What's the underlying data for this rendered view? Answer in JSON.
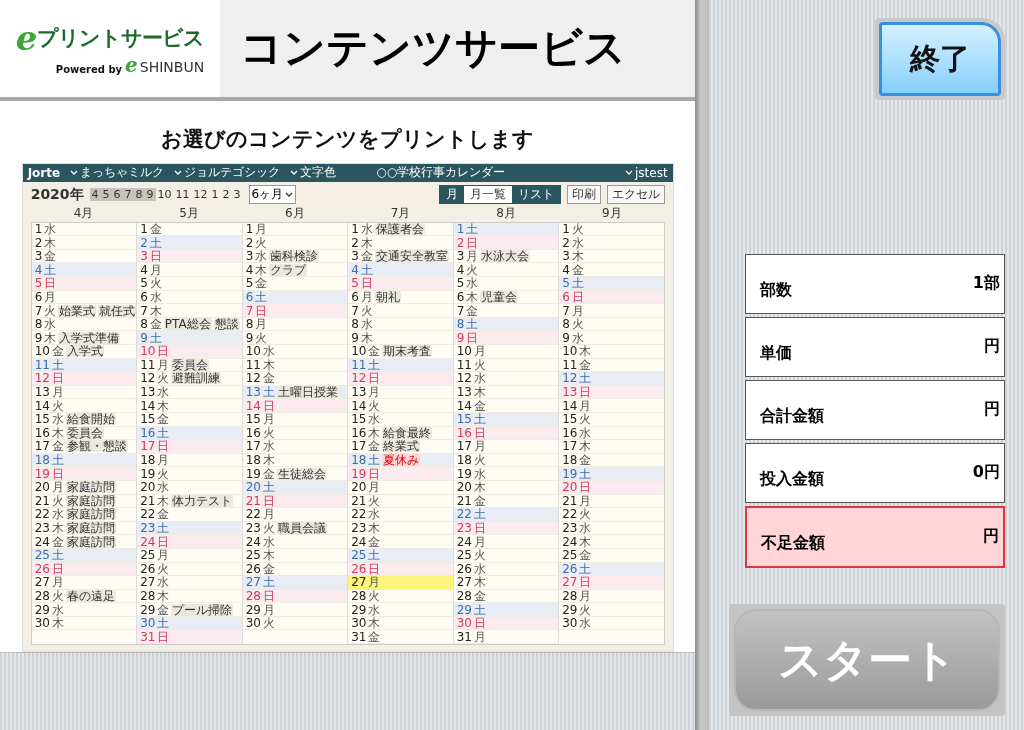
{
  "header": {
    "logo": {
      "mark": "e",
      "name": "プリントサービス",
      "powered_by": "Powered by",
      "partner_mark": "e",
      "partner_name": "SHINBUN"
    },
    "title": "コンテンツサービス"
  },
  "message": "お選びのコンテンツをプリントします",
  "calendar": {
    "app_name": "Jorte",
    "menus": [
      "まっちゃミルク",
      "ジョルテゴシック",
      "文字色"
    ],
    "calendar_name": "○○学校行事カレンダー",
    "user": "jstest",
    "year": "2020年",
    "month_chips": [
      {
        "label": "4",
        "selected": true
      },
      {
        "label": "5",
        "selected": true
      },
      {
        "label": "6",
        "selected": true
      },
      {
        "label": "7",
        "selected": true
      },
      {
        "label": "8",
        "selected": true
      },
      {
        "label": "9",
        "selected": true
      },
      {
        "label": "10",
        "selected": false
      },
      {
        "label": "11",
        "selected": false
      },
      {
        "label": "12",
        "selected": false
      },
      {
        "label": "1",
        "selected": false
      },
      {
        "label": "2",
        "selected": false
      },
      {
        "label": "3",
        "selected": false
      }
    ],
    "range": "6ヶ月",
    "views": [
      {
        "label": "月",
        "selected": true
      },
      {
        "label": "月一覧",
        "selected": false
      },
      {
        "label": "リスト",
        "selected": true
      }
    ],
    "actions": [
      "印刷",
      "エクセル"
    ],
    "months": [
      {
        "title": "4月",
        "days": [
          {
            "d": "1",
            "w": "水",
            "kind": "wd"
          },
          {
            "d": "2",
            "w": "木",
            "kind": "wd"
          },
          {
            "d": "3",
            "w": "金",
            "kind": "wd"
          },
          {
            "d": "4",
            "w": "土",
            "kind": "sat"
          },
          {
            "d": "5",
            "w": "日",
            "kind": "sun"
          },
          {
            "d": "6",
            "w": "月",
            "kind": "wd"
          },
          {
            "d": "7",
            "w": "火",
            "kind": "wd",
            "events": [
              {
                "text": "始業式",
                "kind": "tag"
              },
              {
                "text": "就任式",
                "kind": "tag"
              }
            ]
          },
          {
            "d": "8",
            "w": "水",
            "kind": "wd"
          },
          {
            "d": "9",
            "w": "木",
            "kind": "wd",
            "events": [
              {
                "text": "入学式準備",
                "kind": "tag"
              }
            ]
          },
          {
            "d": "10",
            "w": "金",
            "kind": "wd",
            "events": [
              {
                "text": "入学式",
                "kind": "tag"
              }
            ]
          },
          {
            "d": "11",
            "w": "土",
            "kind": "sat"
          },
          {
            "d": "12",
            "w": "日",
            "kind": "sun"
          },
          {
            "d": "13",
            "w": "月",
            "kind": "wd"
          },
          {
            "d": "14",
            "w": "火",
            "kind": "wd"
          },
          {
            "d": "15",
            "w": "水",
            "kind": "wd",
            "events": [
              {
                "text": "給食開始",
                "kind": "tag"
              }
            ]
          },
          {
            "d": "16",
            "w": "木",
            "kind": "wd",
            "events": [
              {
                "text": "委員会",
                "kind": "tag"
              }
            ]
          },
          {
            "d": "17",
            "w": "金",
            "kind": "wd",
            "events": [
              {
                "text": "参観・懇談",
                "kind": "tag"
              }
            ]
          },
          {
            "d": "18",
            "w": "土",
            "kind": "sat"
          },
          {
            "d": "19",
            "w": "日",
            "kind": "sun"
          },
          {
            "d": "20",
            "w": "月",
            "kind": "wd",
            "events": [
              {
                "text": "家庭訪問",
                "kind": "tag"
              }
            ]
          },
          {
            "d": "21",
            "w": "火",
            "kind": "wd",
            "events": [
              {
                "text": "家庭訪問",
                "kind": "tag"
              }
            ]
          },
          {
            "d": "22",
            "w": "水",
            "kind": "wd",
            "events": [
              {
                "text": "家庭訪問",
                "kind": "tag"
              }
            ]
          },
          {
            "d": "23",
            "w": "木",
            "kind": "wd",
            "events": [
              {
                "text": "家庭訪問",
                "kind": "tag"
              }
            ]
          },
          {
            "d": "24",
            "w": "金",
            "kind": "wd",
            "events": [
              {
                "text": "家庭訪問",
                "kind": "tag"
              }
            ]
          },
          {
            "d": "25",
            "w": "土",
            "kind": "sat"
          },
          {
            "d": "26",
            "w": "日",
            "kind": "sun"
          },
          {
            "d": "27",
            "w": "月",
            "kind": "wd"
          },
          {
            "d": "28",
            "w": "火",
            "kind": "wd",
            "events": [
              {
                "text": "春の遠足",
                "kind": "tag"
              }
            ]
          },
          {
            "d": "29",
            "w": "水",
            "kind": "wd"
          },
          {
            "d": "30",
            "w": "木",
            "kind": "wd"
          }
        ]
      },
      {
        "title": "5月",
        "days": [
          {
            "d": "1",
            "w": "金",
            "kind": "wd"
          },
          {
            "d": "2",
            "w": "土",
            "kind": "sat"
          },
          {
            "d": "3",
            "w": "日",
            "kind": "sun"
          },
          {
            "d": "4",
            "w": "月",
            "kind": "wd"
          },
          {
            "d": "5",
            "w": "火",
            "kind": "wd"
          },
          {
            "d": "6",
            "w": "水",
            "kind": "wd"
          },
          {
            "d": "7",
            "w": "木",
            "kind": "wd"
          },
          {
            "d": "8",
            "w": "金",
            "kind": "wd",
            "events": [
              {
                "text": "PTA総会",
                "kind": "tag"
              },
              {
                "text": "懇談",
                "kind": "tag"
              }
            ]
          },
          {
            "d": "9",
            "w": "土",
            "kind": "sat"
          },
          {
            "d": "10",
            "w": "日",
            "kind": "sun"
          },
          {
            "d": "11",
            "w": "月",
            "kind": "wd",
            "events": [
              {
                "text": "委員会",
                "kind": "tag"
              }
            ]
          },
          {
            "d": "12",
            "w": "火",
            "kind": "wd",
            "events": [
              {
                "text": "避難訓練",
                "kind": "tag"
              }
            ]
          },
          {
            "d": "13",
            "w": "水",
            "kind": "wd"
          },
          {
            "d": "14",
            "w": "木",
            "kind": "wd"
          },
          {
            "d": "15",
            "w": "金",
            "kind": "wd"
          },
          {
            "d": "16",
            "w": "土",
            "kind": "sat"
          },
          {
            "d": "17",
            "w": "日",
            "kind": "sun"
          },
          {
            "d": "18",
            "w": "月",
            "kind": "wd"
          },
          {
            "d": "19",
            "w": "火",
            "kind": "wd"
          },
          {
            "d": "20",
            "w": "水",
            "kind": "wd"
          },
          {
            "d": "21",
            "w": "木",
            "kind": "wd",
            "events": [
              {
                "text": "体力テスト",
                "kind": "tag"
              }
            ]
          },
          {
            "d": "22",
            "w": "金",
            "kind": "wd"
          },
          {
            "d": "23",
            "w": "土",
            "kind": "sat"
          },
          {
            "d": "24",
            "w": "日",
            "kind": "sun"
          },
          {
            "d": "25",
            "w": "月",
            "kind": "wd"
          },
          {
            "d": "26",
            "w": "火",
            "kind": "wd"
          },
          {
            "d": "27",
            "w": "水",
            "kind": "wd"
          },
          {
            "d": "28",
            "w": "木",
            "kind": "wd"
          },
          {
            "d": "29",
            "w": "金",
            "kind": "wd",
            "events": [
              {
                "text": "プール掃除",
                "kind": "tag"
              }
            ]
          },
          {
            "d": "30",
            "w": "土",
            "kind": "sat"
          },
          {
            "d": "31",
            "w": "日",
            "kind": "sun"
          }
        ]
      },
      {
        "title": "6月",
        "days": [
          {
            "d": "1",
            "w": "月",
            "kind": "wd"
          },
          {
            "d": "2",
            "w": "火",
            "kind": "wd"
          },
          {
            "d": "3",
            "w": "水",
            "kind": "wd",
            "events": [
              {
                "text": "歯科検診",
                "kind": "tag"
              }
            ]
          },
          {
            "d": "4",
            "w": "木",
            "kind": "wd",
            "events": [
              {
                "text": "クラブ",
                "kind": "tag"
              }
            ]
          },
          {
            "d": "5",
            "w": "金",
            "kind": "wd"
          },
          {
            "d": "6",
            "w": "土",
            "kind": "sat"
          },
          {
            "d": "7",
            "w": "日",
            "kind": "sun"
          },
          {
            "d": "8",
            "w": "月",
            "kind": "wd"
          },
          {
            "d": "9",
            "w": "火",
            "kind": "wd"
          },
          {
            "d": "10",
            "w": "水",
            "kind": "wd"
          },
          {
            "d": "11",
            "w": "木",
            "kind": "wd"
          },
          {
            "d": "12",
            "w": "金",
            "kind": "wd"
          },
          {
            "d": "13",
            "w": "土",
            "kind": "sat",
            "events": [
              {
                "text": "土曜日授業",
                "kind": "tag"
              }
            ]
          },
          {
            "d": "14",
            "w": "日",
            "kind": "sun"
          },
          {
            "d": "15",
            "w": "月",
            "kind": "wd"
          },
          {
            "d": "16",
            "w": "火",
            "kind": "wd"
          },
          {
            "d": "17",
            "w": "水",
            "kind": "wd"
          },
          {
            "d": "18",
            "w": "木",
            "kind": "wd"
          },
          {
            "d": "19",
            "w": "金",
            "kind": "wd",
            "events": [
              {
                "text": "生徒総会",
                "kind": "tag"
              }
            ]
          },
          {
            "d": "20",
            "w": "土",
            "kind": "sat"
          },
          {
            "d": "21",
            "w": "日",
            "kind": "sun"
          },
          {
            "d": "22",
            "w": "月",
            "kind": "wd"
          },
          {
            "d": "23",
            "w": "火",
            "kind": "wd",
            "events": [
              {
                "text": "職員会議",
                "kind": "tag"
              }
            ]
          },
          {
            "d": "24",
            "w": "水",
            "kind": "wd"
          },
          {
            "d": "25",
            "w": "木",
            "kind": "wd"
          },
          {
            "d": "26",
            "w": "金",
            "kind": "wd"
          },
          {
            "d": "27",
            "w": "土",
            "kind": "sat"
          },
          {
            "d": "28",
            "w": "日",
            "kind": "sun"
          },
          {
            "d": "29",
            "w": "月",
            "kind": "wd"
          },
          {
            "d": "30",
            "w": "火",
            "kind": "wd"
          }
        ]
      },
      {
        "title": "7月",
        "days": [
          {
            "d": "1",
            "w": "水",
            "kind": "wd",
            "events": [
              {
                "text": "保護者会",
                "kind": "tag"
              }
            ]
          },
          {
            "d": "2",
            "w": "木",
            "kind": "wd"
          },
          {
            "d": "3",
            "w": "金",
            "kind": "wd",
            "events": [
              {
                "text": "交通安全教室",
                "kind": "tag"
              }
            ]
          },
          {
            "d": "4",
            "w": "土",
            "kind": "sat"
          },
          {
            "d": "5",
            "w": "日",
            "kind": "sun"
          },
          {
            "d": "6",
            "w": "月",
            "kind": "wd",
            "events": [
              {
                "text": "朝礼",
                "kind": "tag"
              }
            ]
          },
          {
            "d": "7",
            "w": "火",
            "kind": "wd"
          },
          {
            "d": "8",
            "w": "水",
            "kind": "wd"
          },
          {
            "d": "9",
            "w": "木",
            "kind": "wd"
          },
          {
            "d": "10",
            "w": "金",
            "kind": "wd",
            "events": [
              {
                "text": "期末考査",
                "kind": "tag"
              }
            ]
          },
          {
            "d": "11",
            "w": "土",
            "kind": "sat"
          },
          {
            "d": "12",
            "w": "日",
            "kind": "sun"
          },
          {
            "d": "13",
            "w": "月",
            "kind": "wd"
          },
          {
            "d": "14",
            "w": "火",
            "kind": "wd"
          },
          {
            "d": "15",
            "w": "水",
            "kind": "wd"
          },
          {
            "d": "16",
            "w": "木",
            "kind": "wd",
            "events": [
              {
                "text": "給食最終",
                "kind": "tag"
              }
            ]
          },
          {
            "d": "17",
            "w": "金",
            "kind": "wd",
            "events": [
              {
                "text": "終業式",
                "kind": "tag"
              }
            ]
          },
          {
            "d": "18",
            "w": "土",
            "kind": "sat",
            "events": [
              {
                "text": "夏休み",
                "kind": "alert"
              }
            ]
          },
          {
            "d": "19",
            "w": "日",
            "kind": "sun"
          },
          {
            "d": "20",
            "w": "月",
            "kind": "wd"
          },
          {
            "d": "21",
            "w": "火",
            "kind": "wd"
          },
          {
            "d": "22",
            "w": "水",
            "kind": "wd"
          },
          {
            "d": "23",
            "w": "木",
            "kind": "wd"
          },
          {
            "d": "24",
            "w": "金",
            "kind": "wd"
          },
          {
            "d": "25",
            "w": "土",
            "kind": "sat"
          },
          {
            "d": "26",
            "w": "日",
            "kind": "sun"
          },
          {
            "d": "27",
            "w": "月",
            "kind": "today"
          },
          {
            "d": "28",
            "w": "火",
            "kind": "wd"
          },
          {
            "d": "29",
            "w": "水",
            "kind": "wd"
          },
          {
            "d": "30",
            "w": "木",
            "kind": "wd"
          },
          {
            "d": "31",
            "w": "金",
            "kind": "wd"
          }
        ]
      },
      {
        "title": "8月",
        "days": [
          {
            "d": "1",
            "w": "土",
            "kind": "sat"
          },
          {
            "d": "2",
            "w": "日",
            "kind": "sun"
          },
          {
            "d": "3",
            "w": "月",
            "kind": "wd",
            "events": [
              {
                "text": "水泳大会",
                "kind": "tag"
              }
            ]
          },
          {
            "d": "4",
            "w": "火",
            "kind": "wd"
          },
          {
            "d": "5",
            "w": "水",
            "kind": "wd"
          },
          {
            "d": "6",
            "w": "木",
            "kind": "wd",
            "events": [
              {
                "text": "児童会",
                "kind": "tag"
              }
            ]
          },
          {
            "d": "7",
            "w": "金",
            "kind": "wd"
          },
          {
            "d": "8",
            "w": "土",
            "kind": "sat"
          },
          {
            "d": "9",
            "w": "日",
            "kind": "sun"
          },
          {
            "d": "10",
            "w": "月",
            "kind": "wd"
          },
          {
            "d": "11",
            "w": "火",
            "kind": "wd"
          },
          {
            "d": "12",
            "w": "水",
            "kind": "wd"
          },
          {
            "d": "13",
            "w": "木",
            "kind": "wd"
          },
          {
            "d": "14",
            "w": "金",
            "kind": "wd"
          },
          {
            "d": "15",
            "w": "土",
            "kind": "sat"
          },
          {
            "d": "16",
            "w": "日",
            "kind": "sun"
          },
          {
            "d": "17",
            "w": "月",
            "kind": "wd"
          },
          {
            "d": "18",
            "w": "火",
            "kind": "wd"
          },
          {
            "d": "19",
            "w": "水",
            "kind": "wd"
          },
          {
            "d": "20",
            "w": "木",
            "kind": "wd"
          },
          {
            "d": "21",
            "w": "金",
            "kind": "wd"
          },
          {
            "d": "22",
            "w": "土",
            "kind": "sat"
          },
          {
            "d": "23",
            "w": "日",
            "kind": "sun"
          },
          {
            "d": "24",
            "w": "月",
            "kind": "wd"
          },
          {
            "d": "25",
            "w": "火",
            "kind": "wd"
          },
          {
            "d": "26",
            "w": "水",
            "kind": "wd"
          },
          {
            "d": "27",
            "w": "木",
            "kind": "wd"
          },
          {
            "d": "28",
            "w": "金",
            "kind": "wd"
          },
          {
            "d": "29",
            "w": "土",
            "kind": "sat"
          },
          {
            "d": "30",
            "w": "日",
            "kind": "sun"
          },
          {
            "d": "31",
            "w": "月",
            "kind": "wd"
          }
        ]
      },
      {
        "title": "9月",
        "days": [
          {
            "d": "1",
            "w": "火",
            "kind": "wd"
          },
          {
            "d": "2",
            "w": "水",
            "kind": "wd"
          },
          {
            "d": "3",
            "w": "木",
            "kind": "wd"
          },
          {
            "d": "4",
            "w": "金",
            "kind": "wd"
          },
          {
            "d": "5",
            "w": "土",
            "kind": "sat"
          },
          {
            "d": "6",
            "w": "日",
            "kind": "sun"
          },
          {
            "d": "7",
            "w": "月",
            "kind": "wd"
          },
          {
            "d": "8",
            "w": "火",
            "kind": "wd"
          },
          {
            "d": "9",
            "w": "水",
            "kind": "wd"
          },
          {
            "d": "10",
            "w": "木",
            "kind": "wd"
          },
          {
            "d": "11",
            "w": "金",
            "kind": "wd"
          },
          {
            "d": "12",
            "w": "土",
            "kind": "sat"
          },
          {
            "d": "13",
            "w": "日",
            "kind": "sun"
          },
          {
            "d": "14",
            "w": "月",
            "kind": "wd"
          },
          {
            "d": "15",
            "w": "火",
            "kind": "wd"
          },
          {
            "d": "16",
            "w": "水",
            "kind": "wd"
          },
          {
            "d": "17",
            "w": "木",
            "kind": "wd"
          },
          {
            "d": "18",
            "w": "金",
            "kind": "wd"
          },
          {
            "d": "19",
            "w": "土",
            "kind": "sat"
          },
          {
            "d": "20",
            "w": "日",
            "kind": "sun"
          },
          {
            "d": "21",
            "w": "月",
            "kind": "wd"
          },
          {
            "d": "22",
            "w": "火",
            "kind": "wd"
          },
          {
            "d": "23",
            "w": "水",
            "kind": "wd"
          },
          {
            "d": "24",
            "w": "木",
            "kind": "wd"
          },
          {
            "d": "25",
            "w": "金",
            "kind": "wd"
          },
          {
            "d": "26",
            "w": "土",
            "kind": "sat"
          },
          {
            "d": "27",
            "w": "日",
            "kind": "sun"
          },
          {
            "d": "28",
            "w": "月",
            "kind": "wd"
          },
          {
            "d": "29",
            "w": "火",
            "kind": "wd"
          },
          {
            "d": "30",
            "w": "水",
            "kind": "wd"
          }
        ]
      }
    ]
  },
  "exit_button": "終了",
  "summary": [
    {
      "label": "部数",
      "value": "1部",
      "kind": "normal"
    },
    {
      "label": "単価",
      "value": "円",
      "kind": "normal"
    },
    {
      "label": "合計金額",
      "value": "円",
      "kind": "normal"
    },
    {
      "label": "投入金額",
      "value": "0円",
      "kind": "normal"
    },
    {
      "label": "不足金額",
      "value": "円",
      "kind": "alert"
    }
  ],
  "start_button": {
    "label": "スタート",
    "disabled": true
  }
}
